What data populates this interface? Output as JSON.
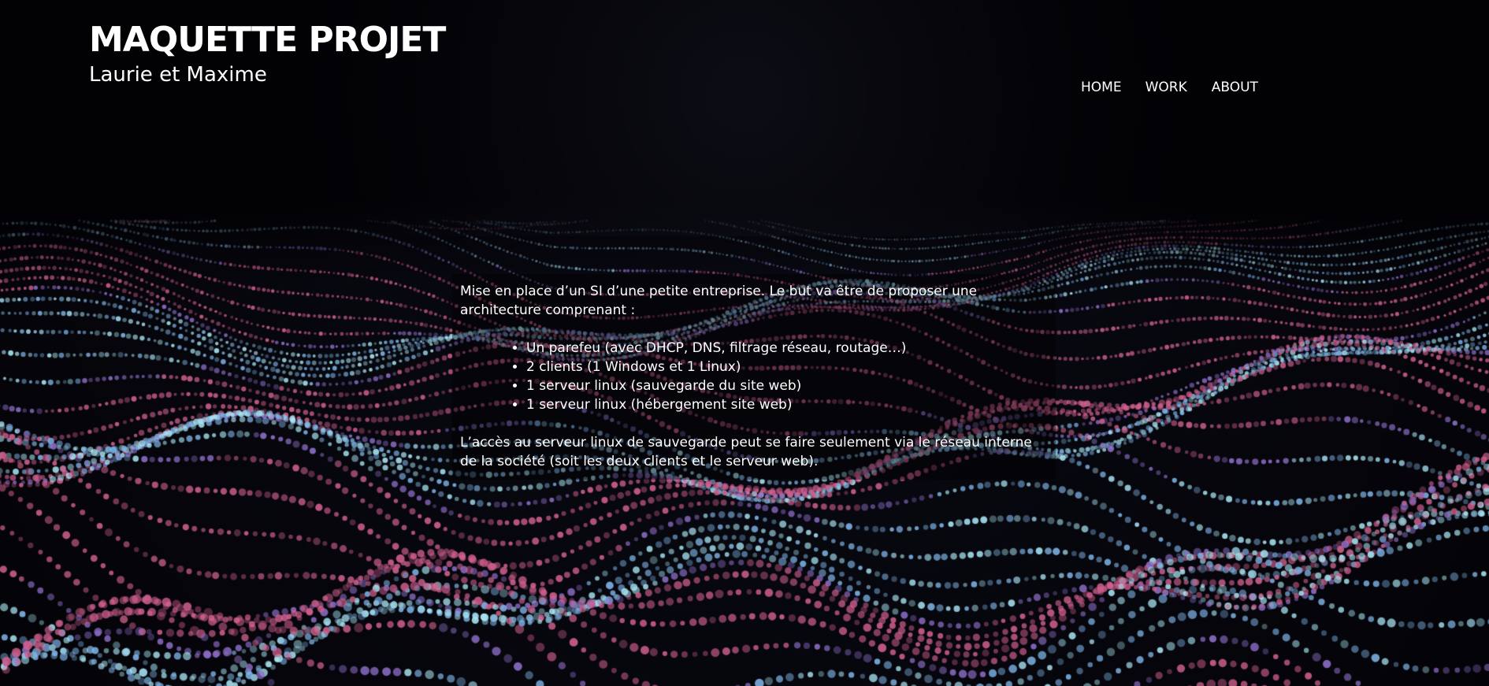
{
  "header": {
    "title": "MAQUETTE PROJET",
    "subtitle": "Laurie et Maxime"
  },
  "nav": {
    "items": [
      {
        "label": "HOME"
      },
      {
        "label": "WORK"
      },
      {
        "label": "ABOUT"
      }
    ]
  },
  "content": {
    "intro": "Mise en place d’un SI d’une petite entreprise. Le but va être de proposer une architecture comprenant :",
    "list": [
      "Un parefeu (avec DHCP, DNS, filtrage réseau, routage…)",
      "2 clients (1 Windows et 1 Linux)",
      "1 serveur linux (sauvegarde du site web)",
      "1 serveur linux (hébergement site web)"
    ],
    "outro": "L’accès au serveur linux de sauvegarde peut se faire seulement via le réseau interne de la société (soit les deux clients et le serveur web)."
  },
  "colors": {
    "background": "#020205",
    "text": "#ffffff",
    "particle_pink": "#d0608e",
    "particle_blue": "#7fb4e6",
    "particle_cyan": "#a8e4f2",
    "particle_violet": "#8e6fc8"
  }
}
